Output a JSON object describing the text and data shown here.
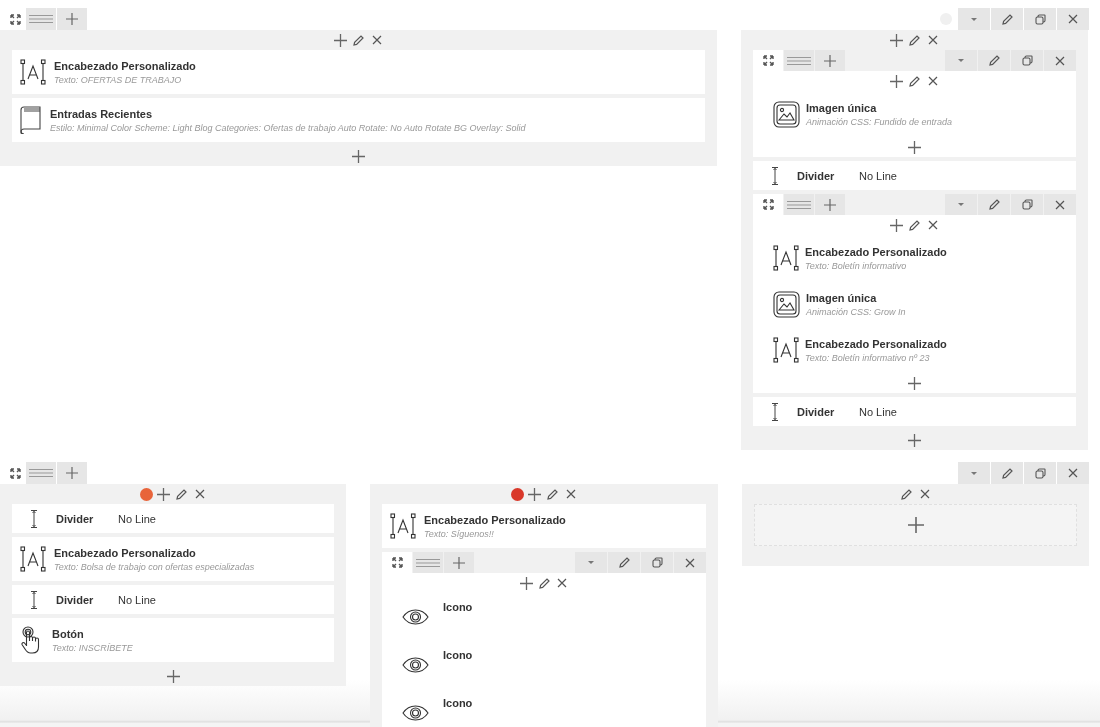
{
  "rows": [
    {
      "color": "#f0f0f0",
      "columns": [
        {
          "kind": "filled",
          "footer": true,
          "items": [
            {
              "kind": "heading",
              "title": "Encabezado Personalizado",
              "subtitle": "Texto: OFERTAS DE TRABAJO"
            },
            {
              "kind": "posts",
              "title": "Entradas Recientes",
              "subtitle": "Estilo: Minimal  Color Scheme: Light  Blog Categories: Ofertas de trabajo  Auto Rotate: No Auto Rotate  BG Overlay: Solid"
            }
          ]
        },
        {
          "kind": "filled",
          "footer": true,
          "items": [
            {
              "kind": "inner_row",
              "footer": true,
              "items": [
                {
                  "kind": "image",
                  "title": "Imagen única",
                  "subtitle": "Animación CSS: Fundido de entrada"
                }
              ]
            },
            {
              "kind": "divider",
              "title": "Divider",
              "value": "No Line"
            },
            {
              "kind": "inner_row",
              "footer": true,
              "items": [
                {
                  "kind": "heading",
                  "title": "Encabezado Personalizado",
                  "subtitle": "Texto: Boletín informativo"
                },
                {
                  "kind": "image",
                  "title": "Imagen única",
                  "subtitle": "Animación CSS: Grow In"
                },
                {
                  "kind": "heading",
                  "title": "Encabezado Personalizado",
                  "subtitle": "Texto: Boletín informativo nº 23"
                }
              ]
            },
            {
              "kind": "divider",
              "title": "Divider",
              "value": "No Line"
            }
          ]
        }
      ]
    },
    {
      "columns": [
        {
          "kind": "filled",
          "color": "#e8643a",
          "footer": true,
          "items": [
            {
              "kind": "divider",
              "title": "Divider",
              "value": "No Line"
            },
            {
              "kind": "heading",
              "title": "Encabezado Personalizado",
              "subtitle": "Texto: Bolsa de trabajo con ofertas especializadas"
            },
            {
              "kind": "divider",
              "title": "Divider",
              "value": "No Line"
            },
            {
              "kind": "button",
              "title": "Botón",
              "subtitle": "Texto: INSCRÍBETE"
            }
          ]
        },
        {
          "kind": "filled",
          "color": "#d9382a",
          "footer": false,
          "items": [
            {
              "kind": "heading",
              "title": "Encabezado Personalizado",
              "subtitle": "Texto: Síguenos!!"
            },
            {
              "kind": "inner_row",
              "footer": false,
              "items": [
                {
                  "kind": "icon",
                  "title": "Icono"
                },
                {
                  "kind": "icon",
                  "title": "Icono"
                },
                {
                  "kind": "icon",
                  "title": "Icono"
                }
              ]
            }
          ]
        },
        {
          "kind": "empty"
        }
      ]
    }
  ]
}
